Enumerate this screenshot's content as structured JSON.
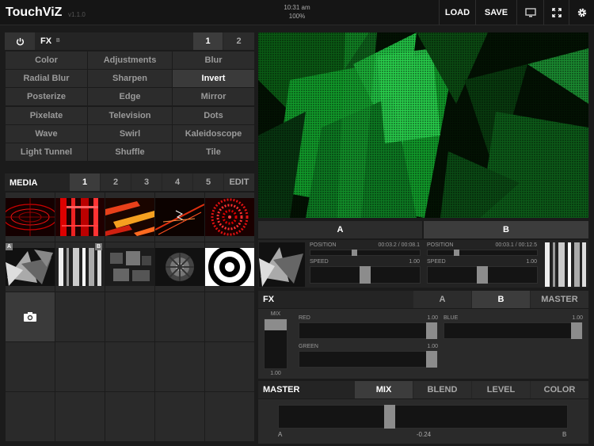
{
  "app": {
    "title": "TouchViZ",
    "version": "v1.1.0",
    "time": "10:31 am",
    "battery": "100%"
  },
  "toolbar": {
    "load": "LOAD",
    "save": "SAVE",
    "monitor_icon": "monitor-icon",
    "fullscreen_icon": "fullscreen-icon",
    "gear_icon": "gear-icon"
  },
  "fx": {
    "title": "FX",
    "target": "B",
    "power_icon": "power-icon",
    "pages": [
      "1",
      "2"
    ],
    "active_page": "1",
    "effects": [
      "Color",
      "Adjustments",
      "Blur",
      "Radial Blur",
      "Sharpen",
      "Invert",
      "Posterize",
      "Edge",
      "Mirror",
      "Pixelate",
      "Television",
      "Dots",
      "Wave",
      "Swirl",
      "Kaleidoscope",
      "Light Tunnel",
      "Shuffle",
      "Tile"
    ],
    "active_effect": "Invert"
  },
  "media": {
    "title": "MEDIA",
    "tabs": [
      "1",
      "2",
      "3",
      "4",
      "5"
    ],
    "edit": "EDIT",
    "active_tab": "1",
    "badge_a": "A",
    "badge_b": "B",
    "camera_icon": "camera-icon"
  },
  "decks": {
    "a": {
      "label": "A",
      "position_label": "POSITION",
      "position_time": "00:03.2 / 00:08.1",
      "position": 0.4,
      "speed_label": "SPEED",
      "speed_value": "1.00",
      "speed": 0.5
    },
    "b": {
      "label": "B",
      "position_label": "POSITION",
      "position_time": "00:03.1 / 00:12.5",
      "position": 0.25,
      "speed_label": "SPEED",
      "speed_value": "1.00",
      "speed": 0.5
    }
  },
  "fx_mix": {
    "title": "FX",
    "tabs": [
      "A",
      "B",
      "MASTER"
    ],
    "active_tab": "B",
    "mix_label": "MIX",
    "mix_value": "1.00",
    "red_label": "RED",
    "red_value": "1.00",
    "green_label": "GREEN",
    "green_value": "1.00",
    "blue_label": "BLUE",
    "blue_value": "1.00"
  },
  "master": {
    "title": "MASTER",
    "tabs": [
      "MIX",
      "BLEND",
      "LEVEL",
      "COLOR"
    ],
    "active_tab": "MIX",
    "left_label": "A",
    "right_label": "B",
    "value": "-0.24",
    "crossfade": -0.24
  }
}
